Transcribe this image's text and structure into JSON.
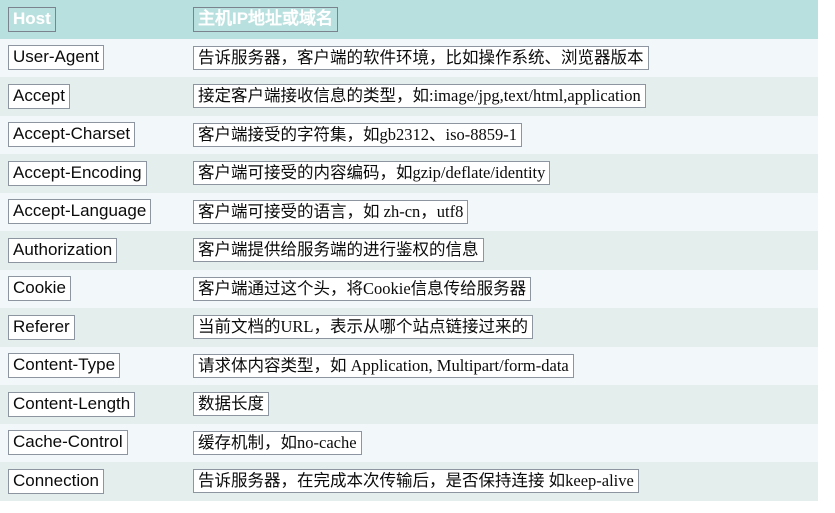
{
  "table": {
    "columns": [
      "Host",
      "主机IP地址或域名"
    ],
    "header": {
      "name": "Host",
      "description": "主机IP地址或域名"
    },
    "theme": {
      "header_bg": "#b8e0de",
      "header_text": "#ffffff",
      "row_tint_bg": "#e4efed",
      "row_plain_bg": "#f2f7fa",
      "chip_border": "#8d96a0",
      "chip_bg": "#ffffff",
      "text": "#0b0b0b",
      "page_bg": "#ffffff"
    },
    "rows": [
      {
        "name": "User-Agent",
        "description": "告诉服务器，客户端的软件环境，比如操作系统、浏览器版本"
      },
      {
        "name": "Accept",
        "description": "接定客户端接收信息的类型，如:image/jpg,text/html,application"
      },
      {
        "name": "Accept-Charset",
        "description": "客户端接受的字符集，如gb2312、iso-8859-1"
      },
      {
        "name": "Accept-Encoding",
        "description": "客户端可接受的内容编码，如gzip/deflate/identity"
      },
      {
        "name": "Accept-Language",
        "description": "客户端可接受的语言，如 zh-cn，utf8"
      },
      {
        "name": "Authorization",
        "description": "客户端提供给服务端的进行鉴权的信息"
      },
      {
        "name": "Cookie",
        "description": "客户端通过这个头，将Cookie信息传给服务器"
      },
      {
        "name": "Referer",
        "description": "当前文档的URL，表示从哪个站点链接过来的"
      },
      {
        "name": "Content-Type",
        "description": "请求体内容类型，如 Application, Multipart/form-data"
      },
      {
        "name": "Content-Length",
        "description": "数据长度"
      },
      {
        "name": "Cache-Control",
        "description": "缓存机制，如no-cache"
      },
      {
        "name": "Connection",
        "description": "告诉服务器，在完成本次传输后，是否保持连接 如keep-alive"
      }
    ]
  }
}
